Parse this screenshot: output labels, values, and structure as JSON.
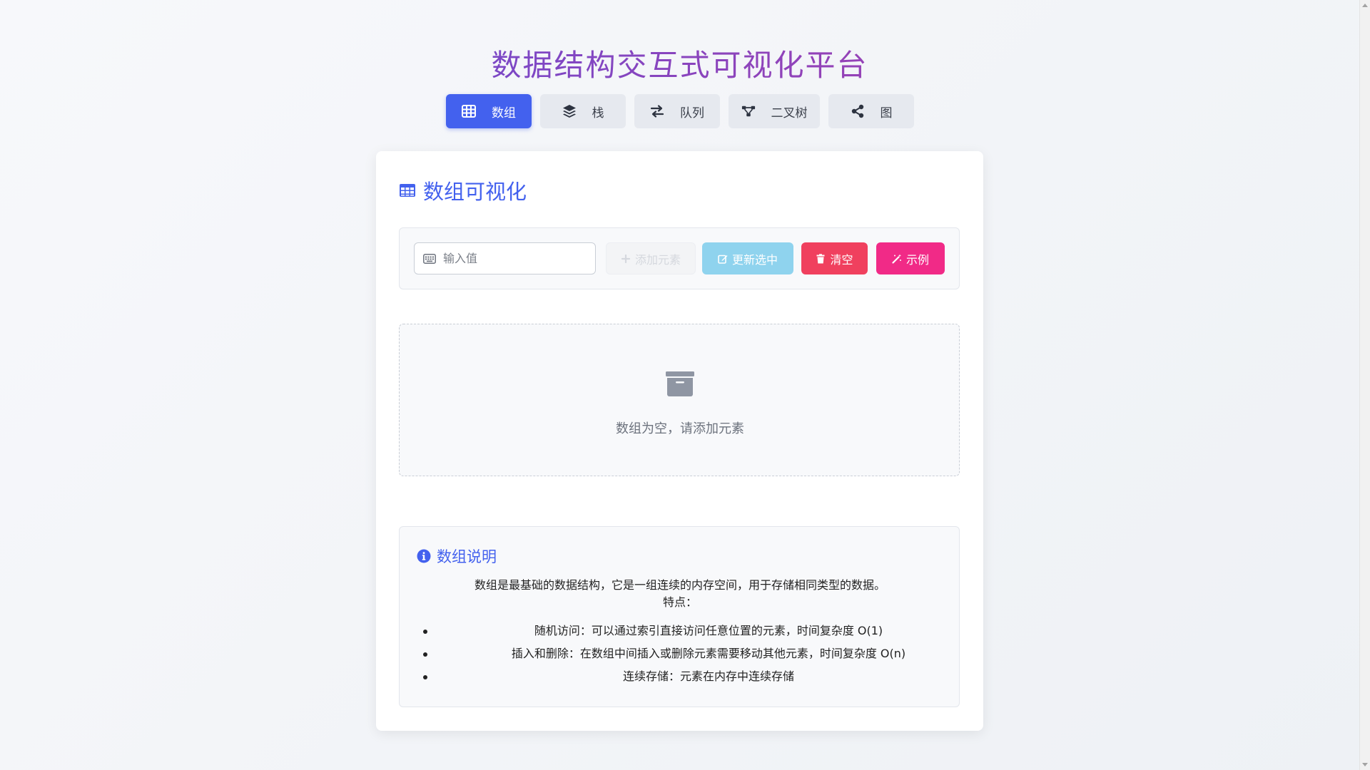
{
  "app": {
    "title": "数据结构交互式可视化平台"
  },
  "nav": {
    "tabs": [
      {
        "label": "数组",
        "icon": "table-icon",
        "active": true
      },
      {
        "label": "栈",
        "icon": "layers-icon",
        "active": false
      },
      {
        "label": "队列",
        "icon": "exchange-icon",
        "active": false
      },
      {
        "label": "二叉树",
        "icon": "tree-icon",
        "active": false
      },
      {
        "label": "图",
        "icon": "share-nodes-icon",
        "active": false
      }
    ]
  },
  "section": {
    "title": "数组可视化",
    "icon": "table-icon"
  },
  "controls": {
    "input_placeholder": "输入值",
    "input_value": "",
    "add_label": "添加元素",
    "update_label": "更新选中",
    "clear_label": "清空",
    "example_label": "示例"
  },
  "empty_state": {
    "icon": "archive-icon",
    "message": "数组为空，请添加元素"
  },
  "info": {
    "title": "数组说明",
    "icon": "info-circle-icon",
    "intro": "数组是最基础的数据结构，它是一组连续的内存空间，用于存储相同类型的数据。",
    "features_label": "特点：",
    "features": [
      "随机访问：可以通过索引直接访问任意位置的元素，时间复杂度 O(1)",
      "插入和删除：在数组中间插入或删除元素需要移动其他元素，时间复杂度 O(n)",
      "连续存储：元素在内存中连续存储"
    ]
  },
  "colors": {
    "primary": "#4361ee",
    "info_button": "#8fd3ee",
    "danger_button": "#f0405e",
    "accent_button": "#f12a87",
    "title_gradient_start": "#5b4fd9",
    "title_gradient_end": "#b63aa3"
  }
}
